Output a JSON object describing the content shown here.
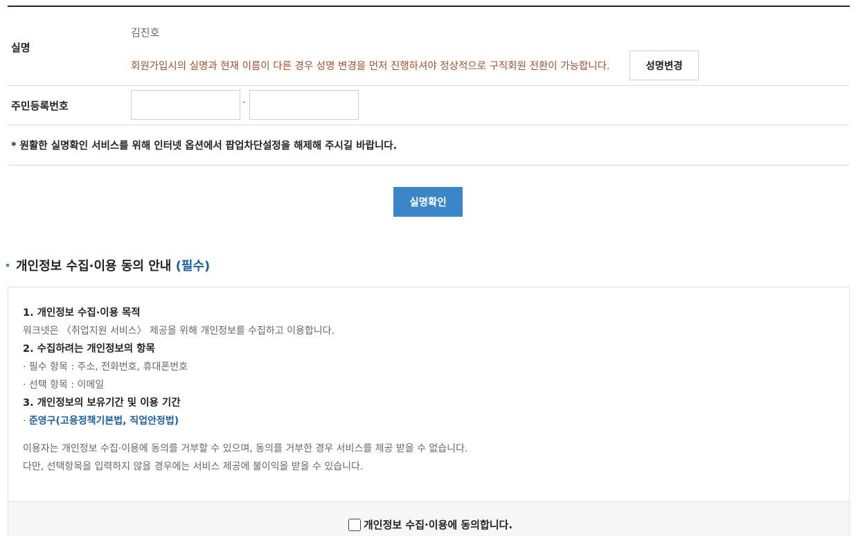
{
  "name_row": {
    "label": "실명",
    "value": "김진호",
    "warning": "회원가입시의 실명과 현재 이름이 다른 경우 성명 변경을 먼저 진행하셔야 정상적으로 구직회원 전환이 가능합니다.",
    "change_button": "성명변경"
  },
  "rrn_row": {
    "label": "주민등록번호",
    "first_value": "",
    "second_value": "",
    "separator": "-"
  },
  "notice": "* 원활한 실명확인 서비스를 위해 인터넷 옵션에서 팝업차단설정을 해제해 주시길 바랍니다.",
  "verify_button": "실명확인",
  "section": {
    "title": "개인정보 수집·이용 동의 안내",
    "required": "(필수)"
  },
  "consent": {
    "h1": "1. 개인정보 수집·이용 목적",
    "p1": "워크넷은 〈취업지원 서비스〉 제공을 위해 개인정보를 수집하고 이용합니다.",
    "h2": "2. 수집하려는 개인정보의 항목",
    "p2a": "· 필수 항목 : 주소, 전화번호, 휴대폰번호",
    "p2b": "· 선택 항목 : 이메일",
    "h3": "3. 개인정보의 보유기간 및 이용 기간",
    "p3_prefix": "· ",
    "p3_law": "준영구(고용정책기본법, 직업안정법)",
    "note1": "이용자는 개인정보 수집·이용에 동의를 거부할 수 있으며, 동의를 거부한 경우 서비스를 제공 받을 수 없습니다.",
    "note2": "다만, 선택항목을 입력하지 않을 경우에는 서비스 제공에 불이익을 받을 수 있습니다.",
    "agree_label": "개인정보 수집·이용에 동의합니다."
  },
  "colors": {
    "primary_button": "#3a86c8",
    "warning_text": "#a0522d",
    "link_blue": "#1f5fa0"
  }
}
